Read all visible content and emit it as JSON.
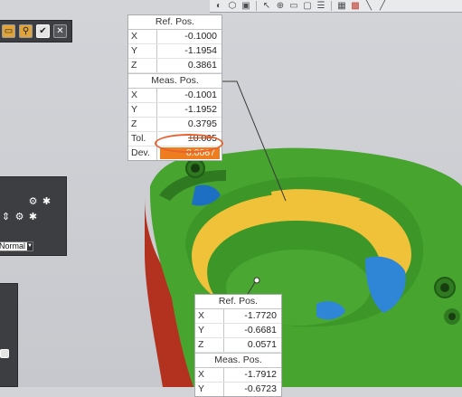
{
  "toolbar": {
    "icons": [
      "sphere-view-icon",
      "cube-view-icon",
      "box-view-icon",
      "cursor-icon",
      "measure-icon",
      "window-icon",
      "frame-icon",
      "checklist-icon",
      "grid-icon",
      "color-grid-icon",
      "diagonal-icon",
      "slash-icon"
    ]
  },
  "top_left_panel": {
    "buttons": [
      "folder-icon",
      "search-icon",
      "check-icon",
      "close-icon"
    ]
  },
  "left_panel": {
    "row1_icons": [
      "gear-icon",
      "bug-icon"
    ],
    "row2_icons": [
      "spin-icon",
      "gear-icon",
      "bug-icon"
    ],
    "dropdown_value": "Normal"
  },
  "tag_top": {
    "ref_header": "Ref. Pos.",
    "ref": [
      {
        "k": "X",
        "v": "-0.1000"
      },
      {
        "k": "Y",
        "v": "-1.1954"
      },
      {
        "k": "Z",
        "v": "0.3861"
      }
    ],
    "meas_header": "Meas. Pos.",
    "meas": [
      {
        "k": "X",
        "v": "-0.1001"
      },
      {
        "k": "Y",
        "v": "-1.1952"
      },
      {
        "k": "Z",
        "v": "0.3795"
      }
    ],
    "tol": {
      "k": "Tol.",
      "v": "±0.005"
    },
    "dev": {
      "k": "Dev.",
      "v": "0.0067"
    }
  },
  "tag_bottom": {
    "ref_header": "Ref. Pos.",
    "ref": [
      {
        "k": "X",
        "v": "-1.7720"
      },
      {
        "k": "Y",
        "v": "-0.6681"
      },
      {
        "k": "Z",
        "v": "0.0571"
      }
    ],
    "meas_header": "Meas. Pos.",
    "meas": [
      {
        "k": "X",
        "v": "-1.7912"
      },
      {
        "k": "Y",
        "v": "-0.6723"
      }
    ]
  },
  "colors": {
    "green": "#4aa832",
    "yellow": "#f0c23a",
    "blue": "#2f86d6",
    "red": "#b3321f",
    "orange": "#ee7d1f"
  }
}
